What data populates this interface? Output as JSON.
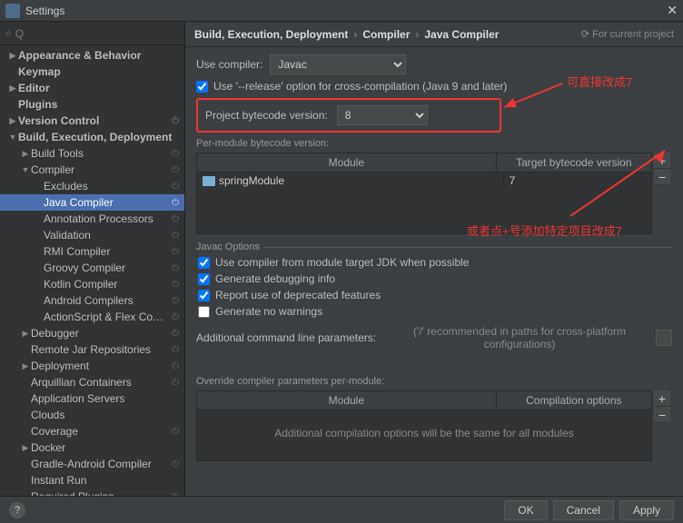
{
  "window": {
    "title": "Settings"
  },
  "search": {
    "placeholder": "Q"
  },
  "tree": [
    {
      "label": "Appearance & Behavior",
      "depth": 0,
      "arrow": "▶",
      "bold": true
    },
    {
      "label": "Keymap",
      "depth": 0,
      "arrow": "",
      "bold": true
    },
    {
      "label": "Editor",
      "depth": 0,
      "arrow": "▶",
      "bold": true
    },
    {
      "label": "Plugins",
      "depth": 0,
      "arrow": "",
      "bold": true
    },
    {
      "label": "Version Control",
      "depth": 0,
      "arrow": "▶",
      "bold": true,
      "badge": "⏻"
    },
    {
      "label": "Build, Execution, Deployment",
      "depth": 0,
      "arrow": "▼",
      "bold": true
    },
    {
      "label": "Build Tools",
      "depth": 1,
      "arrow": "▶",
      "badge": "⏻"
    },
    {
      "label": "Compiler",
      "depth": 1,
      "arrow": "▼",
      "badge": "⏻"
    },
    {
      "label": "Excludes",
      "depth": 2,
      "arrow": "",
      "badge": "⏻"
    },
    {
      "label": "Java Compiler",
      "depth": 2,
      "arrow": "",
      "badge": "⏻",
      "selected": true
    },
    {
      "label": "Annotation Processors",
      "depth": 2,
      "arrow": "",
      "badge": "⏻"
    },
    {
      "label": "Validation",
      "depth": 2,
      "arrow": "",
      "badge": "⏻"
    },
    {
      "label": "RMI Compiler",
      "depth": 2,
      "arrow": "",
      "badge": "⏻"
    },
    {
      "label": "Groovy Compiler",
      "depth": 2,
      "arrow": "",
      "badge": "⏻"
    },
    {
      "label": "Kotlin Compiler",
      "depth": 2,
      "arrow": "",
      "badge": "⏻"
    },
    {
      "label": "Android Compilers",
      "depth": 2,
      "arrow": "",
      "badge": "⏻"
    },
    {
      "label": "ActionScript & Flex Compiler",
      "depth": 2,
      "arrow": "",
      "badge": "⏻"
    },
    {
      "label": "Debugger",
      "depth": 1,
      "arrow": "▶",
      "badge": "⏻"
    },
    {
      "label": "Remote Jar Repositories",
      "depth": 1,
      "arrow": "",
      "badge": "⏻"
    },
    {
      "label": "Deployment",
      "depth": 1,
      "arrow": "▶",
      "badge": "⏻"
    },
    {
      "label": "Arquillian Containers",
      "depth": 1,
      "arrow": "",
      "badge": "⏻"
    },
    {
      "label": "Application Servers",
      "depth": 1,
      "arrow": ""
    },
    {
      "label": "Clouds",
      "depth": 1,
      "arrow": ""
    },
    {
      "label": "Coverage",
      "depth": 1,
      "arrow": "",
      "badge": "⏻"
    },
    {
      "label": "Docker",
      "depth": 1,
      "arrow": "▶"
    },
    {
      "label": "Gradle-Android Compiler",
      "depth": 1,
      "arrow": "",
      "badge": "⏻"
    },
    {
      "label": "Instant Run",
      "depth": 1,
      "arrow": ""
    },
    {
      "label": "Required Plugins",
      "depth": 1,
      "arrow": "",
      "badge": "⏻"
    }
  ],
  "breadcrumb": {
    "a": "Build, Execution, Deployment",
    "b": "Compiler",
    "c": "Java Compiler",
    "current_project": "For current project"
  },
  "compiler": {
    "use_compiler_label": "Use compiler:",
    "use_compiler_value": "Javac",
    "release_checkbox_label": "Use '--release' option for cross-compilation (Java 9 and later)",
    "release_checked": true,
    "project_bytecode_label": "Project bytecode version:",
    "project_bytecode_value": "8",
    "per_module_label": "Per-module bytecode version:",
    "module_header": "Module",
    "target_header": "Target bytecode version",
    "modules": [
      {
        "name": "springModule",
        "target": "7"
      }
    ]
  },
  "javac": {
    "legend": "Javac Options",
    "use_module_jdk": "Use compiler from module target JDK when possible",
    "use_module_jdk_checked": true,
    "gen_debug": "Generate debugging info",
    "gen_debug_checked": true,
    "report_deprecated": "Report use of deprecated features",
    "report_deprecated_checked": true,
    "no_warnings": "Generate no warnings",
    "no_warnings_checked": false,
    "cmdline_label": "Additional command line parameters:",
    "cmdline_hint": "('/' recommended in paths for cross-platform configurations)"
  },
  "override": {
    "label": "Override compiler parameters per-module:",
    "module_header": "Module",
    "options_header": "Compilation options",
    "empty_msg": "Additional compilation options will be the same for all modules"
  },
  "footer": {
    "ok": "OK",
    "cancel": "Cancel",
    "apply": "Apply"
  },
  "annotations": {
    "a1": "可直接改成7",
    "a2": "或者点+号添加特定项目改成7"
  }
}
